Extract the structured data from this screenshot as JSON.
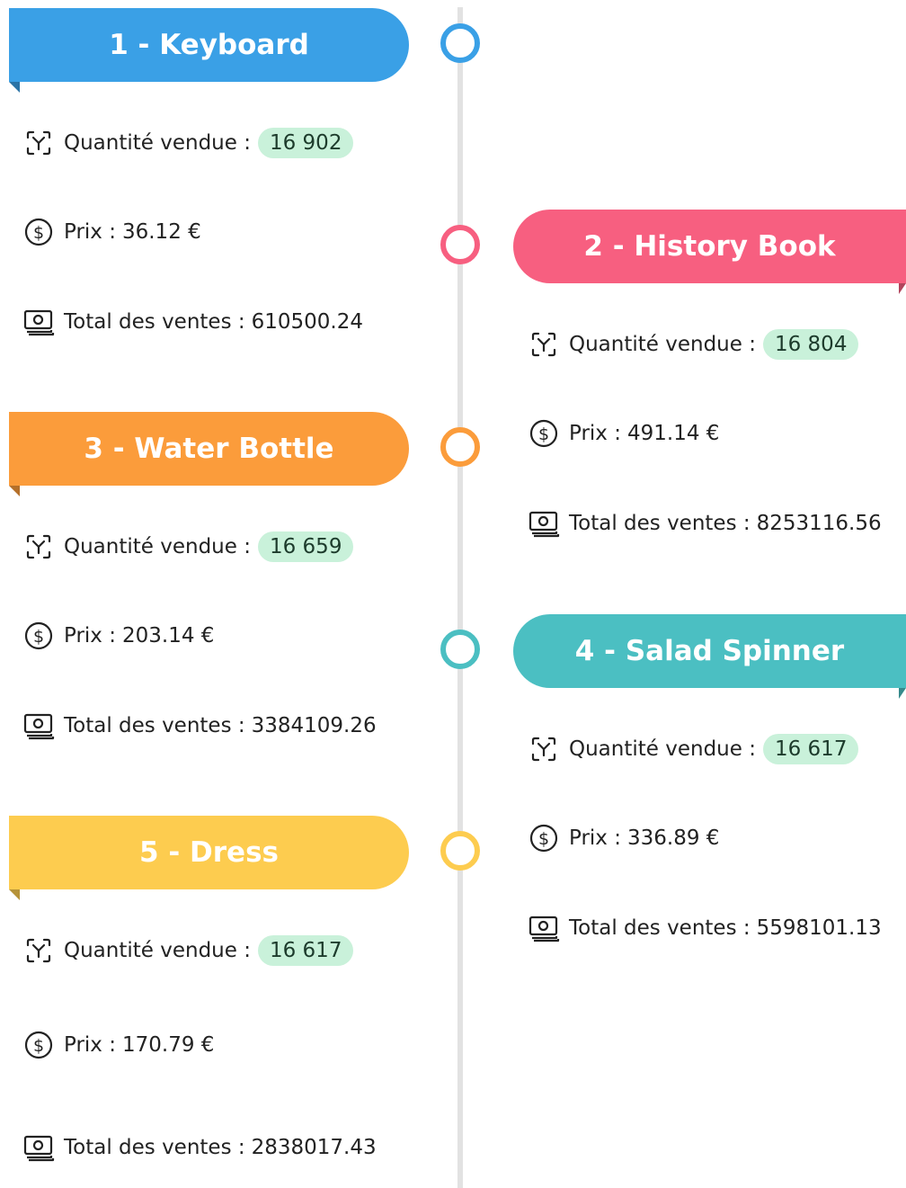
{
  "labels": {
    "quantity": "Quantité vendue :",
    "price": "Prix :",
    "total": "Total des ventes :"
  },
  "items": [
    {
      "title": "1 - Keyboard",
      "color": "#3aa0e6",
      "quantity": "16 902",
      "price": "36.12 €",
      "total": "610500.24"
    },
    {
      "title": "2 - History Book",
      "color": "#f75f80",
      "quantity": "16 804",
      "price": "491.14 €",
      "total": "8253116.56"
    },
    {
      "title": "3 - Water Bottle",
      "color": "#fb9c3b",
      "quantity": "16 659",
      "price": "203.14 €",
      "total": "3384109.26"
    },
    {
      "title": "4 - Salad Spinner",
      "color": "#4bbfc2",
      "quantity": "16 617",
      "price": "336.89 €",
      "total": "5598101.13"
    },
    {
      "title": "5 - Dress",
      "color": "#fdcc4f",
      "quantity": "16 617",
      "price": "170.79 €",
      "total": "2838017.43"
    }
  ],
  "icons": {
    "quantity": "quantity-scan-icon",
    "price": "dollar-circle-icon",
    "total": "money-bill-icon"
  }
}
